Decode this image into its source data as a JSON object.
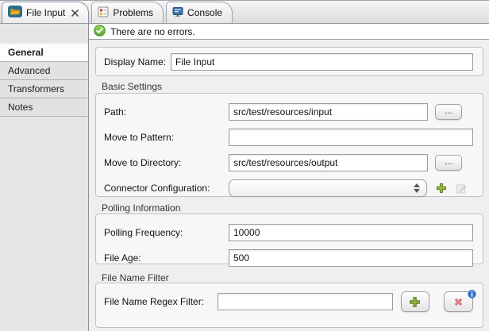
{
  "tabs": {
    "file_input": {
      "label": "File Input"
    },
    "problems": {
      "label": "Problems"
    },
    "console": {
      "label": "Console"
    }
  },
  "status": {
    "message": "There are no errors."
  },
  "sidebar": {
    "selected": "General",
    "items": [
      {
        "label": "General"
      },
      {
        "label": "Advanced"
      },
      {
        "label": "Transformers"
      },
      {
        "label": "Notes"
      }
    ]
  },
  "form": {
    "display_name": {
      "label": "Display Name:",
      "value": "File Input"
    },
    "basic": {
      "title": "Basic Settings",
      "path": {
        "label": "Path:",
        "value": "src/test/resources/input",
        "browse_label": "..."
      },
      "move_to_pattern": {
        "label": "Move to Pattern:",
        "value": ""
      },
      "move_to_directory": {
        "label": "Move to Directory:",
        "value": "src/test/resources/output",
        "browse_label": "..."
      },
      "connector_configuration": {
        "label": "Connector Configuration:",
        "value": ""
      }
    },
    "polling": {
      "title": "Polling Information",
      "polling_frequency": {
        "label": "Polling Frequency:",
        "value": "10000"
      },
      "file_age": {
        "label": "File Age:",
        "value": "500"
      }
    },
    "filter": {
      "title": "File Name Filter",
      "file_name_regex": {
        "label": "File Name Regex Filter:",
        "value": ""
      }
    }
  },
  "icons": {
    "tab_file": "folder-icon",
    "tab_close": "close-icon",
    "tab_problems": "problems-icon",
    "tab_console": "console-icon",
    "status_ok": "check-circle-icon",
    "add": "plus-icon",
    "edit": "edit-icon",
    "delete": "delete-x-icon",
    "info": "info-icon"
  },
  "colors": {
    "status_green": "#5aa52c",
    "add_green": "#8db33c",
    "delete_red": "#dd8484",
    "info_blue": "#2d70c8",
    "folder_badge_blue": "#2c6e91",
    "folder_orange": "#f0ad2d"
  }
}
